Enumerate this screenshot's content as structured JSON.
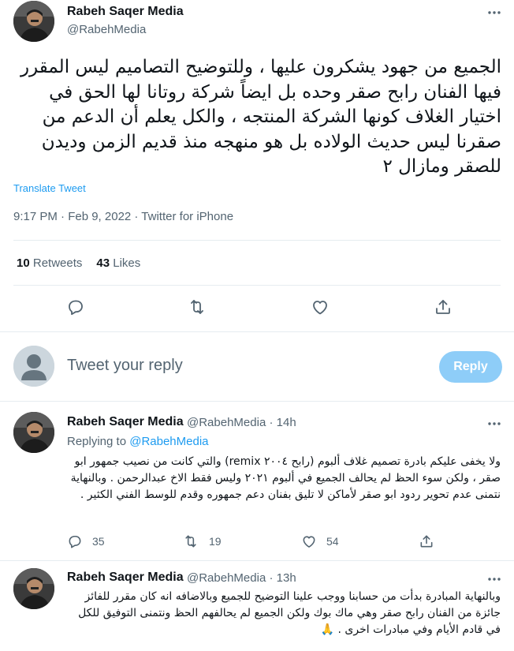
{
  "main_tweet": {
    "author_name": "Rabeh Saqer Media",
    "author_handle": "@RabehMedia",
    "text": "الجميع من جهود يشكرون عليها ، وللتوضيح التصاميم ليس المقرر فيها الفنان رابح صقر وحده بل ايضاً شركة روتانا لها الحق في اختيار الغلاف كونها الشركة المنتجه ، والكل يعلم أن الدعم من صقرنا ليس حديث الولاده بل هو منهجه منذ قديم الزمن وديدن للصقر ومازال ٢",
    "translate_label": "Translate Tweet",
    "timestamp": "9:17 PM · Feb 9, 2022 · Twitter for iPhone",
    "retweets_count": "10",
    "retweets_label": "Retweets",
    "likes_count": "43",
    "likes_label": "Likes"
  },
  "compose": {
    "placeholder": "Tweet your reply",
    "reply_button": "Reply"
  },
  "replies": [
    {
      "author_name": "Rabeh Saqer Media",
      "author_handle": "@RabehMedia",
      "time": "· 14h",
      "replying_prefix": "Replying to",
      "replying_to": "@RabehMedia",
      "text": "ولا يخفى عليكم بادرة تصميم غلاف ألبوم (رابح ٢٠٠٤ remix) والتي كانت من نصيب جمهور ابو صقر ، ولكن سوء الحظ لم يحالف الجميع في ألبوم ٢٠٢١ وليس فقط الاخ عبدالرحمن . وبالنهاية نتمنى عدم تحوير ردود ابو صقر لأماكن لا تليق بفنان دعم جمهوره وقدم للوسط الفني الكثير .",
      "reply_count": "35",
      "retweet_count": "19",
      "like_count": "54"
    },
    {
      "author_name": "Rabeh Saqer Media",
      "author_handle": "@RabehMedia",
      "time": "· 13h",
      "text": "وبالنهاية المبادرة بدأت من حسابنا ووجب علينا التوضيح للجميع وبالاضافه انه كان مقرر للفائز جائزة من الفنان رابح صقر وهي ماك بوك ولكن الجميع لم يحالفهم الحظ ونتمنى التوفيق للكل في قادم الأيام وفي مبادرات اخرى . 🙏"
    }
  ],
  "colors": {
    "accent": "#1d9bf0",
    "reply_button_disabled": "#8ecdf8",
    "secondary_text": "#536471",
    "divider": "#e6ecf0"
  },
  "icons": [
    "more-icon",
    "reply-icon",
    "retweet-icon",
    "like-icon",
    "share-icon",
    "default-avatar-icon",
    "praying-hands-emoji"
  ]
}
